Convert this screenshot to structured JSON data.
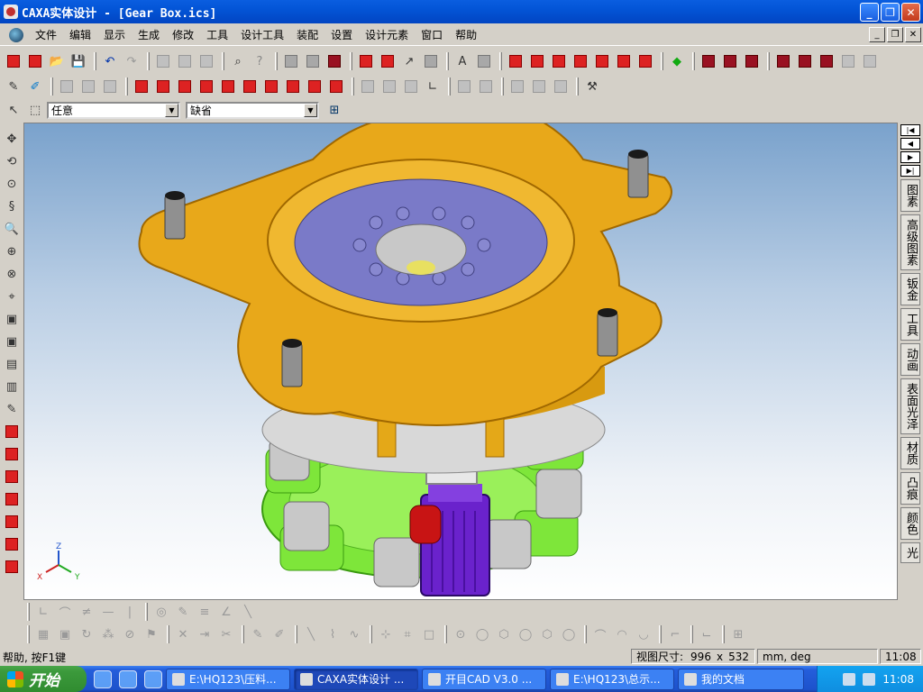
{
  "window": {
    "title": "CAXA实体设计 - [Gear Box.ics]"
  },
  "menu": [
    "文件",
    "编辑",
    "显示",
    "生成",
    "修改",
    "工具",
    "设计工具",
    "装配",
    "设置",
    "设计元素",
    "窗口",
    "帮助"
  ],
  "selectors": {
    "filter": "任意",
    "mode": "缺省"
  },
  "design_tabs": [
    "图素",
    "高级图素",
    "钣金",
    "工具",
    "动画",
    "表面光泽",
    "材质",
    "凸痕",
    "颜色",
    "光"
  ],
  "axis": {
    "z": "Z",
    "x": "X",
    "y": "Y"
  },
  "status": {
    "help": "帮助, 按F1键",
    "view_size_label": "视图尺寸:",
    "view_width": "996",
    "times": "x",
    "view_height": "532",
    "units": "mm, deg",
    "time": "11:08"
  },
  "taskbar": {
    "start": "开始",
    "tasks": [
      "E:\\HQ123\\压料...",
      "CAXA实体设计 ...",
      "开目CAD V3.0 ...",
      "E:\\HQ123\\总示...",
      "我的文档"
    ],
    "clock": "11:08"
  },
  "colors": {
    "title_blue": "#0354d6",
    "housing": "#e8a81a",
    "base_plate": "#7ee63a",
    "motor": "#6a22cc",
    "handle": "#c81414"
  }
}
